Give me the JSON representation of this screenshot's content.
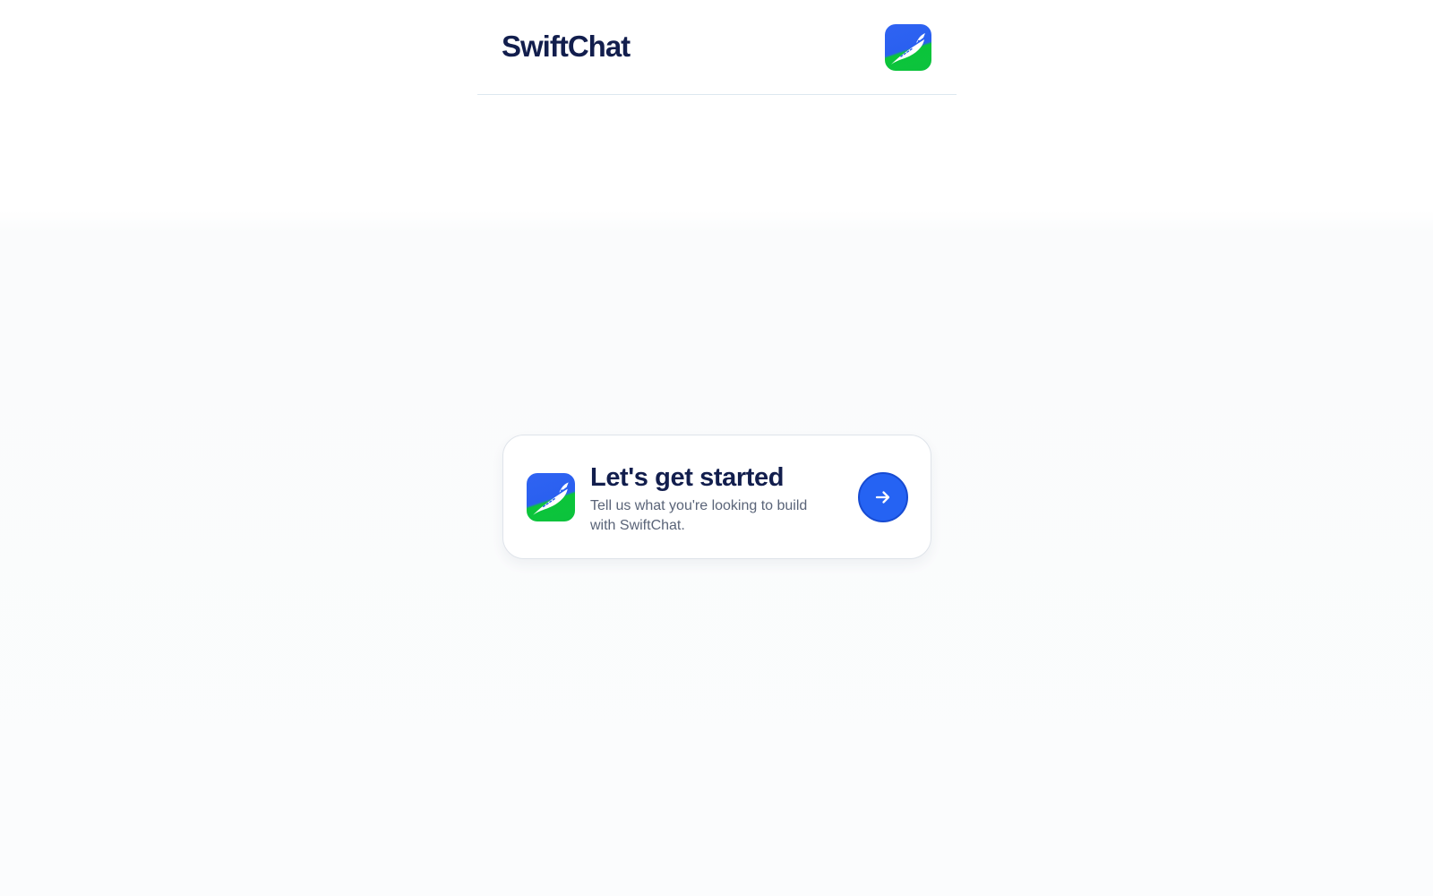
{
  "header": {
    "brand_title": "SwiftChat",
    "app_icon": "swiftchat-bird-logo-icon"
  },
  "start_card": {
    "title": "Let's get started",
    "subtitle": "Tell us what you're looking to build with SwiftChat.",
    "app_icon": "swiftchat-bird-logo-icon",
    "action_icon": "arrow-right-icon"
  },
  "colors": {
    "brand_navy": "#121e4d",
    "brand_blue": "#2a60f0",
    "brand_green": "#0bc53a",
    "button_blue": "#2563f3",
    "subtitle_gray": "#5a6478"
  }
}
